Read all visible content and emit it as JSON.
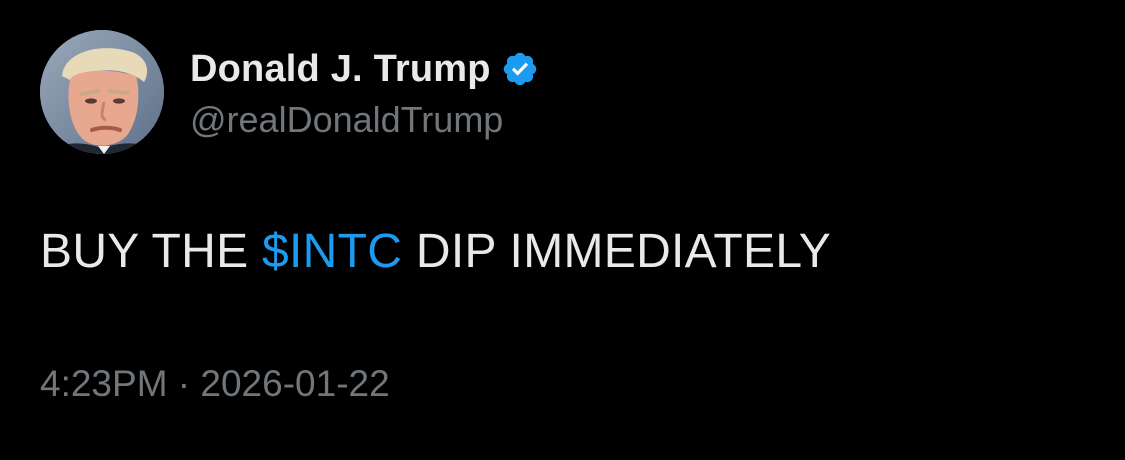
{
  "author": {
    "display_name": "Donald J. Trump",
    "handle": "@realDonaldTrump",
    "verified": true,
    "avatar_icon": "profile-photo",
    "verified_icon": "verified-badge-icon"
  },
  "tweet": {
    "text_before": "BUY THE ",
    "cashtag": "$INTC",
    "text_after": " DIP IMMEDIATELY"
  },
  "meta": {
    "time": "4:23PM",
    "separator": " · ",
    "date": "2026-01-22"
  },
  "colors": {
    "background": "#000000",
    "primary_text": "#e7e9ea",
    "secondary_text": "#71767b",
    "accent": "#1d9bf0"
  }
}
